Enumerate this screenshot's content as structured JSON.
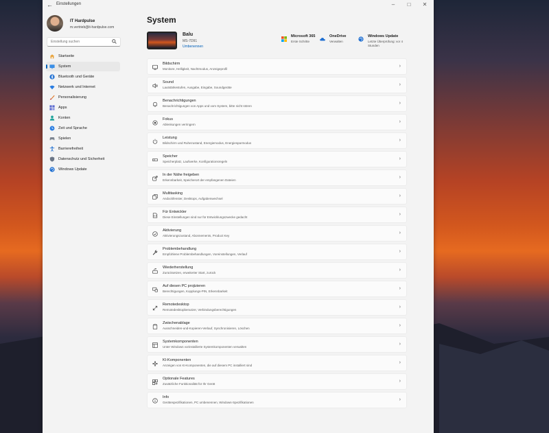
{
  "window": {
    "title": "Einstellungen",
    "back_icon": "back-arrow-icon",
    "controls": [
      "minimize",
      "maximize",
      "close"
    ]
  },
  "profile": {
    "name": "IT Hardpulse",
    "email": "m.vertrieb@it-hardpulse.com"
  },
  "search": {
    "placeholder": "Einstellung suchen"
  },
  "sidebar": {
    "items": [
      {
        "label": "Startseite",
        "icon": "home-icon",
        "active": false
      },
      {
        "label": "System",
        "icon": "monitor-icon",
        "active": true
      },
      {
        "label": "Bluetooth und Geräte",
        "icon": "bluetooth-icon",
        "active": false
      },
      {
        "label": "Netzwerk und Internet",
        "icon": "wifi-icon",
        "active": false
      },
      {
        "label": "Personalisierung",
        "icon": "brush-icon",
        "active": false
      },
      {
        "label": "Apps",
        "icon": "apps-icon",
        "active": false
      },
      {
        "label": "Konten",
        "icon": "person-icon",
        "active": false
      },
      {
        "label": "Zeit und Sprache",
        "icon": "clock-globe-icon",
        "active": false
      },
      {
        "label": "Spielen",
        "icon": "gamepad-icon",
        "active": false
      },
      {
        "label": "Barrierefreiheit",
        "icon": "accessibility-icon",
        "active": false
      },
      {
        "label": "Datenschutz und Sicherheit",
        "icon": "shield-icon",
        "active": false
      },
      {
        "label": "Windows Update",
        "icon": "update-icon",
        "active": false
      }
    ]
  },
  "main": {
    "title": "System",
    "device": {
      "name": "Balu",
      "model": "MS-7D91",
      "rename": "Umbenennen"
    },
    "quick": [
      {
        "title": "Microsoft 365",
        "subtitle": "Erste Schritte",
        "icon": "microsoft-365-icon"
      },
      {
        "title": "OneDrive",
        "subtitle": "Verwalten",
        "icon": "onedrive-icon"
      },
      {
        "title": "Windows Update",
        "subtitle": "Letzte Überprüfung: vor 4 Stunden",
        "icon": "update-icon"
      }
    ],
    "rows": [
      {
        "title": "Bildschirm",
        "subtitle": "Monitore, Helligkeit, Nachtmodus, Anzeigeprofil",
        "icon": "display-icon"
      },
      {
        "title": "Sound",
        "subtitle": "Lautstärkestufen, Ausgabe, Eingabe, Soundgeräte",
        "icon": "speaker-icon"
      },
      {
        "title": "Benachrichtigungen",
        "subtitle": "Benachrichtigungen von Apps und vom System, bitte nicht stören",
        "icon": "bell-icon"
      },
      {
        "title": "Fokus",
        "subtitle": "Ablenkungen verringern",
        "icon": "focus-icon"
      },
      {
        "title": "Leistung",
        "subtitle": "Bildschirm und Ruhezustand, Energiemodus, Energiesparmodus",
        "icon": "power-icon"
      },
      {
        "title": "Speicher",
        "subtitle": "Speicherplatz, Laufwerke, Konfigurationsregeln",
        "icon": "storage-icon"
      },
      {
        "title": "In der Nähe freigeben",
        "subtitle": "Erkennbarkeit, Speicherort der empfangenen Dateien",
        "icon": "share-icon"
      },
      {
        "title": "Multitasking",
        "subtitle": "Andockfenster, Desktops, Aufgabenwechsel",
        "icon": "multitasking-icon"
      },
      {
        "title": "Für Entwickler",
        "subtitle": "Diese Einstellungen sind nur für Entwicklungszwecke gedacht",
        "icon": "developer-icon"
      },
      {
        "title": "Aktivierung",
        "subtitle": "Aktivierungszustand, Abonnements, Product Key",
        "icon": "check-circle-icon"
      },
      {
        "title": "Problembehandlung",
        "subtitle": "Empfohlene Problembehandlungen, Voreinstellungen, Verlauf",
        "icon": "wrench-icon"
      },
      {
        "title": "Wiederherstellung",
        "subtitle": "Zurücksetzen, erweiterter Start, zurück",
        "icon": "recovery-icon"
      },
      {
        "title": "Auf diesen PC projizieren",
        "subtitle": "Berechtigungen, Kopplungs-PIN, Erkennbarkeit",
        "icon": "project-icon"
      },
      {
        "title": "Remotedesktop",
        "subtitle": "Remotedesktopbenutzer, Verbindungsberechtigungen",
        "icon": "remote-desktop-icon"
      },
      {
        "title": "Zwischenablage",
        "subtitle": "Ausschneiden-und-Kopieren-Verlauf, Synchronisieren, Löschen",
        "icon": "clipboard-icon"
      },
      {
        "title": "Systemkomponenten",
        "subtitle": "Unter Windows vorinstallierte Systemkomponenten verwalten",
        "icon": "components-icon"
      },
      {
        "title": "KI-Komponenten",
        "subtitle": "Anzeigen von KI-Komponenten, die auf diesem PC installiert sind",
        "icon": "ai-components-icon"
      },
      {
        "title": "Optionale Features",
        "subtitle": "Zusätzliche Funktionalität für Ihr Gerät",
        "icon": "optional-features-icon"
      },
      {
        "title": "Info",
        "subtitle": "Gerätespezifikationen, PC umbenennen, Windows-Spezifikationen",
        "icon": "info-icon"
      }
    ]
  },
  "colors": {
    "accent": "#005fb8",
    "window_bg": "#f3f3f3",
    "card_bg": "#fbfbfb"
  }
}
